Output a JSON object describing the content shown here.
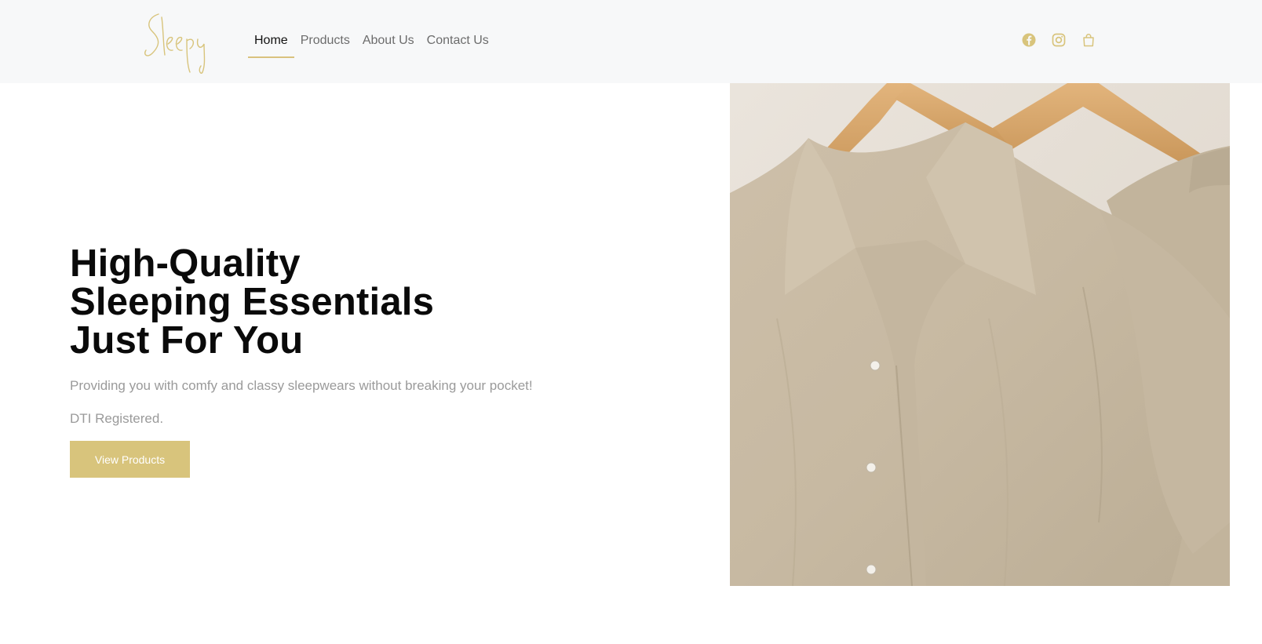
{
  "brand": {
    "logo_text": "Sleepy",
    "accent": "#d8c47c"
  },
  "nav": {
    "items": [
      {
        "label": "Home",
        "active": true
      },
      {
        "label": "Products",
        "active": false
      },
      {
        "label": "About Us",
        "active": false
      },
      {
        "label": "Contact Us",
        "active": false
      }
    ]
  },
  "header_icons": [
    "facebook-icon",
    "instagram-icon",
    "shopping-bag-icon"
  ],
  "hero": {
    "title_line1": "High-Quality",
    "title_line2": "Sleeping Essentials",
    "title_line3": "Just For You",
    "subtitle": "Providing you with comfy and classy sleepwears without breaking your pocket!",
    "registration": "DTI Registered.",
    "cta_label": "View Products"
  },
  "colors": {
    "header_bg": "#f7f8f9",
    "muted_text": "#9a9a9a",
    "button_bg": "#d8c47c"
  }
}
